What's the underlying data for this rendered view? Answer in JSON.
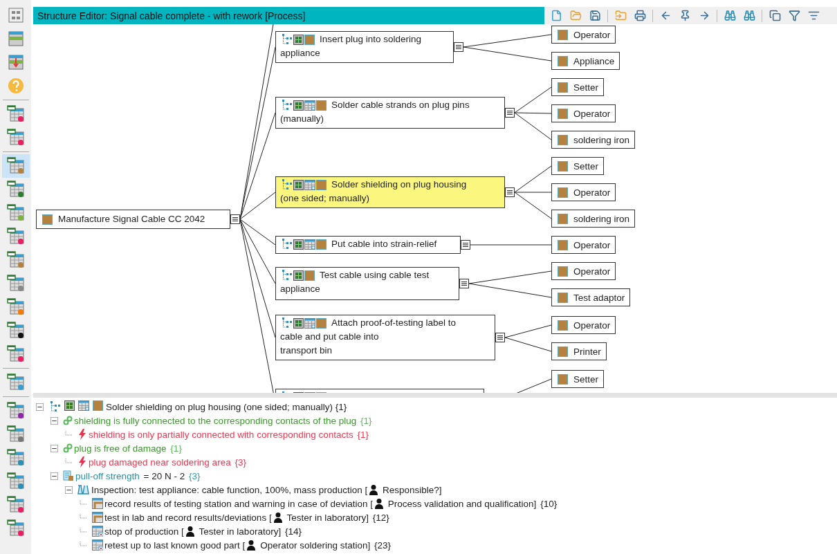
{
  "sidebar": {
    "items": [
      {
        "kind": "button",
        "selected": false
      },
      {
        "kind": "button",
        "selected": false
      },
      {
        "kind": "button",
        "selected": false
      },
      {
        "kind": "button",
        "selected": false
      },
      {
        "kind": "separator"
      },
      {
        "kind": "button",
        "selected": false
      },
      {
        "kind": "button",
        "selected": false
      },
      {
        "kind": "separator"
      },
      {
        "kind": "button",
        "selected": true
      },
      {
        "kind": "button",
        "selected": false
      },
      {
        "kind": "button",
        "selected": false
      },
      {
        "kind": "button",
        "selected": false
      },
      {
        "kind": "button",
        "selected": false
      },
      {
        "kind": "button",
        "selected": false
      },
      {
        "kind": "button",
        "selected": false
      },
      {
        "kind": "button",
        "selected": false
      },
      {
        "kind": "button",
        "selected": false
      },
      {
        "kind": "separator"
      },
      {
        "kind": "button",
        "selected": false
      },
      {
        "kind": "separator"
      },
      {
        "kind": "button",
        "selected": false
      },
      {
        "kind": "button",
        "selected": false
      },
      {
        "kind": "button",
        "selected": false
      },
      {
        "kind": "button",
        "selected": false
      },
      {
        "kind": "button",
        "selected": false
      },
      {
        "kind": "button",
        "selected": false
      }
    ]
  },
  "editor": {
    "title": "Structure Editor: Signal cable complete - with rework [Process]",
    "root": {
      "label": "Manufacture Signal Cable CC 2042",
      "expanded": true
    },
    "processes": [
      {
        "lines": [
          "Insert plug into soldering",
          "appliance"
        ],
        "table_icon": false,
        "selected": false,
        "expanded": true,
        "resources": [
          {
            "label": "Operator"
          },
          {
            "label": "Appliance"
          }
        ]
      },
      {
        "lines": [
          "Solder cable strands on plug pins",
          "(manually)"
        ],
        "table_icon": true,
        "selected": false,
        "expanded": true,
        "resources": [
          {
            "label": "Setter"
          },
          {
            "label": "Operator"
          },
          {
            "label": "soldering iron"
          }
        ]
      },
      {
        "lines": [
          "Solder shielding on plug housing",
          "(one sided; manually)"
        ],
        "table_icon": true,
        "selected": true,
        "expanded": true,
        "resources": [
          {
            "label": "Setter"
          },
          {
            "label": "Operator"
          },
          {
            "label": "soldering iron"
          }
        ]
      },
      {
        "lines": [
          "Put cable into strain-relief"
        ],
        "table_icon": true,
        "selected": false,
        "expanded": true,
        "resources": [
          {
            "label": "Operator"
          }
        ]
      },
      {
        "lines": [
          "Test cable using cable test",
          "appliance"
        ],
        "table_icon": false,
        "selected": false,
        "expanded": true,
        "resources": [
          {
            "label": "Operator"
          },
          {
            "label": "Test adaptor"
          }
        ]
      },
      {
        "lines": [
          "Attach proof-of-testing label to",
          "cable and put cable into",
          "transport bin"
        ],
        "table_icon": true,
        "selected": false,
        "expanded": true,
        "resources": [
          {
            "label": "Operator"
          },
          {
            "label": "Printer"
          }
        ]
      },
      {
        "table_icon": true,
        "selected": false,
        "resources": [
          {
            "label": "Setter"
          }
        ]
      }
    ]
  },
  "tree": {
    "root": {
      "kind": "process",
      "text": "Solder shielding on plug housing (one sided; manually) {1}",
      "expanded": true,
      "children": [
        {
          "kind": "function",
          "text": "shielding is fully connected to the corresponding contacts of the plug",
          "count": "{1}",
          "expanded": true,
          "children": [
            {
              "kind": "failure",
              "text": "shielding is only partially connected with corresponding contacts",
              "count": "{1}"
            }
          ]
        },
        {
          "kind": "function",
          "text": "plug is free of damage",
          "count": "{1}",
          "expanded": true,
          "children": [
            {
              "kind": "failure",
              "text": "plug damaged near soldering area",
              "count": "{3}"
            }
          ]
        },
        {
          "kind": "characteristic",
          "text": "pull-off strength",
          "value": "= 20 N - 2",
          "count": "{3}",
          "expanded": true,
          "children": [
            {
              "kind": "inspection",
              "text": "Inspection: test appliance: cable function, 100%, mass production [",
              "person": "Responsible?]",
              "expanded": true,
              "children": [
                {
                  "kind": "measure",
                  "text": "record results of testing station and warning in case of deviation  [",
                  "person": "Process validation and qualification]",
                  "count": "{10}"
                },
                {
                  "kind": "measure",
                  "text": "test in lab and record results/deviations [",
                  "person": "Tester in laboratory]",
                  "count": "{12}"
                },
                {
                  "kind": "reaction",
                  "text": "stop of production [",
                  "person": "Tester in laboratory]",
                  "count": "{14}"
                },
                {
                  "kind": "reaction",
                  "text": "retest up to last known good part [",
                  "person": "Operator soldering station]",
                  "count": "{23}"
                }
              ]
            }
          ]
        }
      ]
    }
  }
}
